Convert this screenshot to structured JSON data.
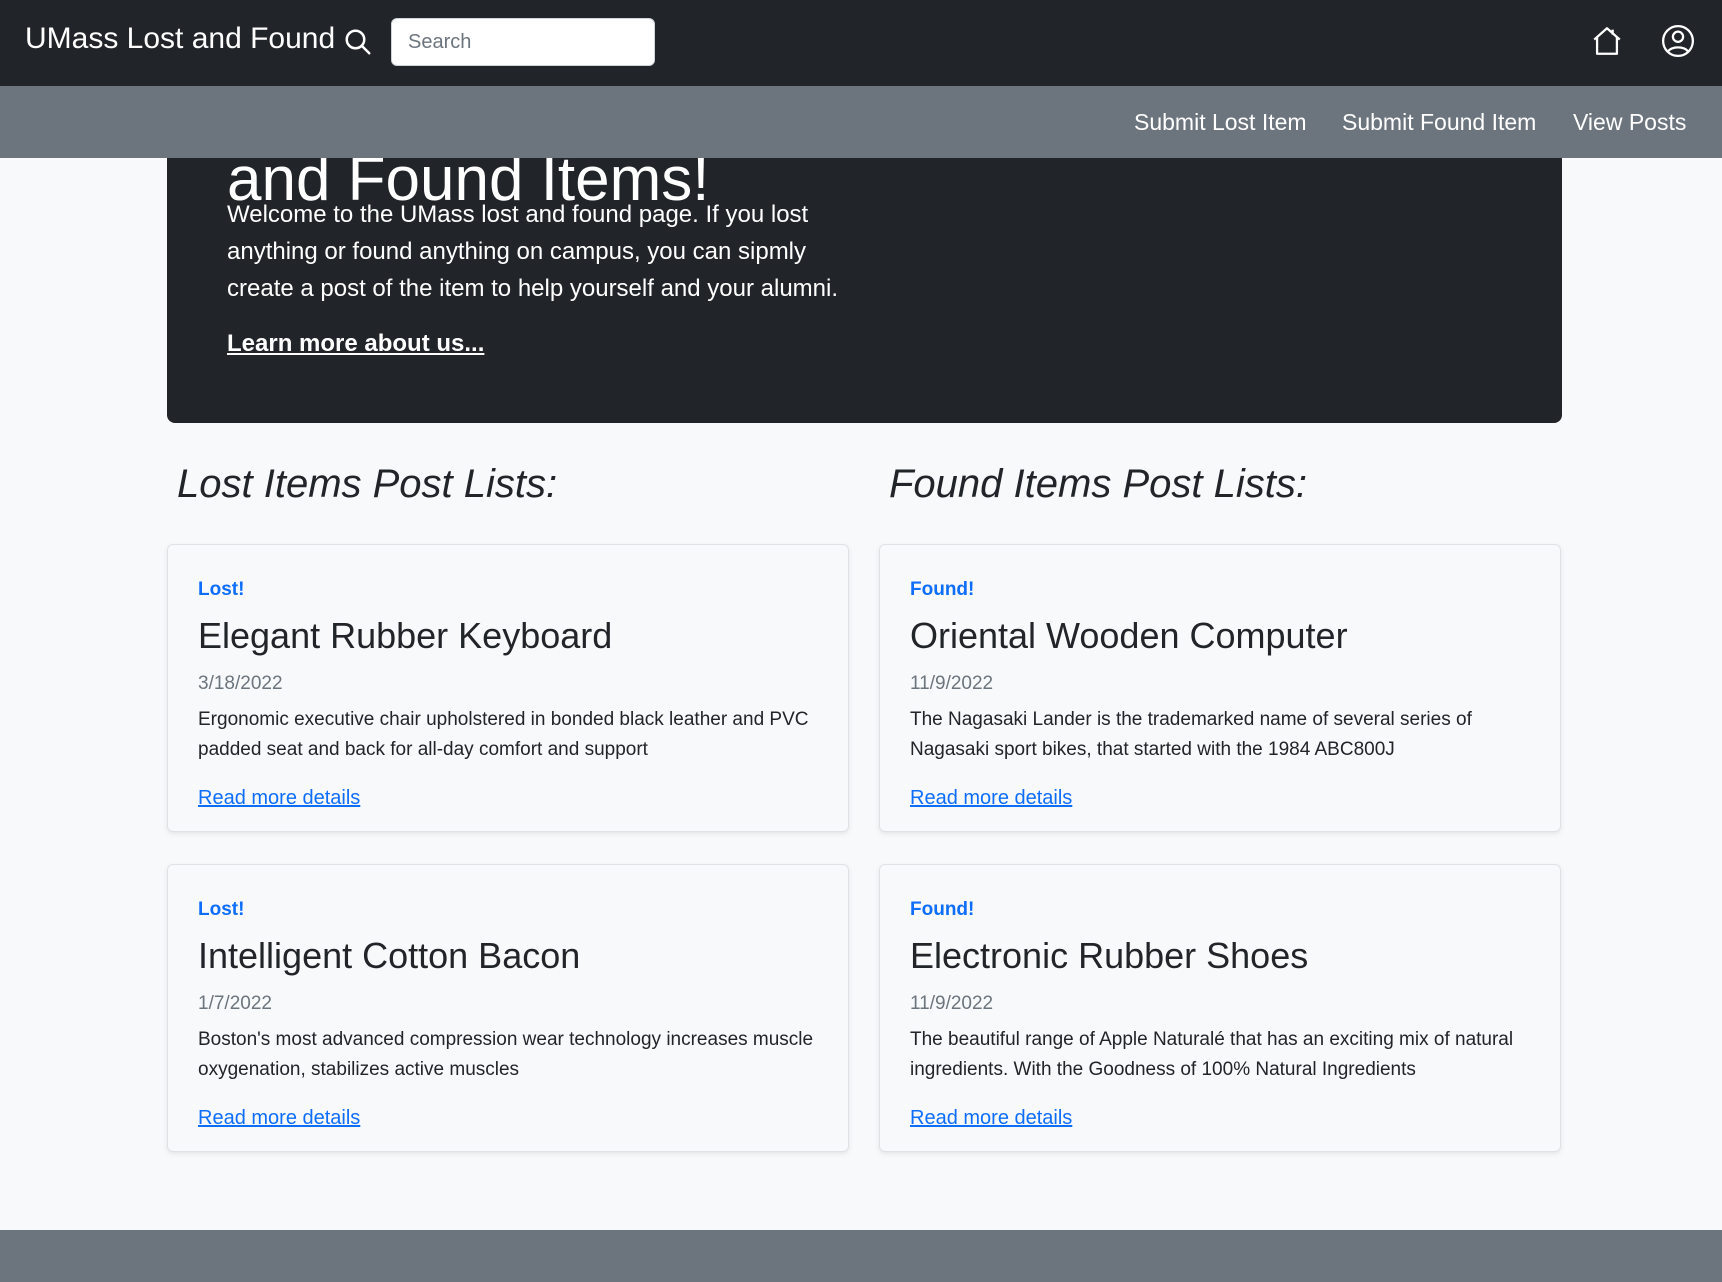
{
  "header": {
    "brand": "UMass Lost and Found",
    "search_placeholder": "Search"
  },
  "subnav": {
    "items": [
      {
        "label": "Submit Lost Item"
      },
      {
        "label": "Submit Found Item"
      },
      {
        "label": "View Posts"
      }
    ]
  },
  "hero": {
    "heading": "and Found Items!",
    "text": "Welcome to the UMass lost and found page. If you lost anything or found anything on campus, you can sipmly create a post of the item to help yourself and your alumni.",
    "link": "Learn more about us..."
  },
  "lost": {
    "title": "Lost Items Post Lists:",
    "posts": [
      {
        "badge": "Lost!",
        "title": "Elegant Rubber Keyboard",
        "date": "3/18/2022",
        "description": "Ergonomic executive chair upholstered in bonded black leather and PVC padded seat and back for all-day comfort and support",
        "link": "Read more details"
      },
      {
        "badge": "Lost!",
        "title": "Intelligent Cotton Bacon",
        "date": "1/7/2022",
        "description": "Boston's most advanced compression wear technology increases muscle oxygenation, stabilizes active muscles",
        "link": "Read more details"
      }
    ]
  },
  "found": {
    "title": "Found Items Post Lists:",
    "posts": [
      {
        "badge": "Found!",
        "title": "Oriental Wooden Computer",
        "date": "11/9/2022",
        "description": "The Nagasaki Lander is the trademarked name of several series of Nagasaki sport bikes, that started with the 1984 ABC800J",
        "link": "Read more details"
      },
      {
        "badge": "Found!",
        "title": "Electronic Rubber Shoes",
        "date": "11/9/2022",
        "description": "The beautiful range of Apple Naturalé that has an exciting mix of natural ingredients. With the Goodness of 100% Natural Ingredients",
        "link": "Read more details"
      }
    ]
  },
  "icons": {
    "search": "search-icon",
    "home": "home-icon",
    "account": "user-circle-icon"
  },
  "colors": {
    "navbar": "#212529",
    "subnav": "#6c757d",
    "accent": "#0d6efd",
    "background": "#f8f9fa"
  }
}
